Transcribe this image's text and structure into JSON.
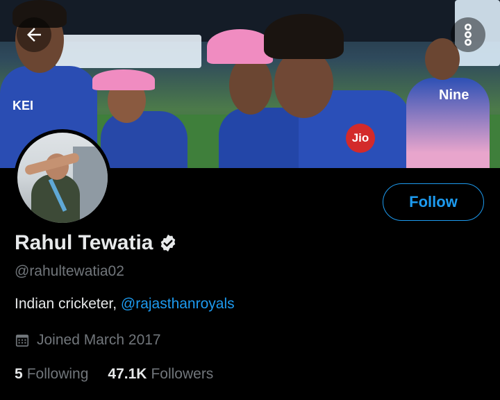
{
  "header": {
    "back_icon": "arrow-left-icon",
    "more_icon": "more-vertical-icon"
  },
  "banner": {
    "sponsor_left": "KEI",
    "sponsor_right": "Jio",
    "sponsor_far_right": "Nine"
  },
  "profile": {
    "name": "Rahul Tewatia",
    "verified_icon": "verified-badge-icon",
    "handle": "@rahultewatia02",
    "bio_text": "Indian cricketer, ",
    "bio_mention": "@rajasthanroyals",
    "joined_icon": "calendar-icon",
    "joined": "Joined March 2017",
    "following_count": "5",
    "following_label": "Following",
    "followers_count": "47.1K",
    "followers_label": "Followers"
  },
  "actions": {
    "follow_label": "Follow"
  },
  "colors": {
    "accent": "#1d9bf0",
    "background": "#000000",
    "secondary_text": "#71767b"
  }
}
